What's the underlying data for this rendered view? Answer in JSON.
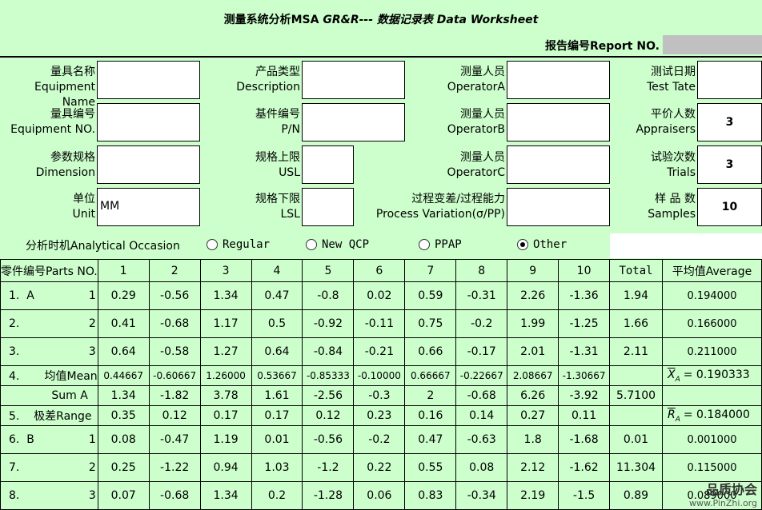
{
  "title": {
    "prefix": "测量系统分析MSA  ",
    "italic": "GR&R--- 数据记录表 Data Worksheet"
  },
  "report": {
    "label": "报告编号Report NO.",
    "value": ""
  },
  "fields": {
    "equipment_name": {
      "cn": "量具名称",
      "en": "Equipment Name",
      "value": ""
    },
    "equipment_no": {
      "cn": "量具编号",
      "en": "Equipment NO.",
      "value": ""
    },
    "dimension": {
      "cn": "参数规格",
      "en": "Dimension",
      "value": ""
    },
    "unit": {
      "cn": "单位",
      "en": "Unit",
      "value": "MM"
    },
    "description": {
      "cn": "产品类型",
      "en": "Description",
      "value": ""
    },
    "pn": {
      "cn": "基件编号",
      "en": "P/N",
      "value": ""
    },
    "usl": {
      "cn": "规格上限",
      "en": "USL",
      "value": ""
    },
    "lsl": {
      "cn": "规格下限",
      "en": "LSL",
      "value": ""
    },
    "operator_a": {
      "cn": "测量人员",
      "en": "OperatorA",
      "value": ""
    },
    "operator_b": {
      "cn": "测量人员",
      "en": "OperatorB",
      "value": ""
    },
    "operator_c": {
      "cn": "测量人员",
      "en": "OperatorC",
      "value": ""
    },
    "process_variation": {
      "cn": "过程变差/过程能力",
      "en": "Process Variation(σ/PP)",
      "value": ""
    },
    "test_date": {
      "cn": "测试日期",
      "en": "Test Tate",
      "value": ""
    },
    "appraisers": {
      "cn": "平价人数",
      "en": "Appraisers",
      "value": "3"
    },
    "trials": {
      "cn": "试验次数",
      "en": "Trials",
      "value": "3"
    },
    "samples": {
      "cn": "样 品 数",
      "en": "Samples",
      "value": "10"
    }
  },
  "occasion": {
    "label": "分析时机Analytical Occasion",
    "options": [
      "Regular",
      "New QCP",
      "PPAP",
      "Other"
    ],
    "selected": "Other"
  },
  "table": {
    "header_parts": "零件编号Parts NO.",
    "cols": [
      "1",
      "2",
      "3",
      "4",
      "5",
      "6",
      "7",
      "8",
      "9",
      "10"
    ],
    "total": "Total",
    "average": "平均值Average",
    "rows": [
      {
        "label": "1.  A",
        "num": "1",
        "vals": [
          "0.29",
          "-0.56",
          "1.34",
          "0.47",
          "-0.8",
          "0.02",
          "0.59",
          "-0.31",
          "2.26",
          "-1.36"
        ],
        "total": "1.94",
        "avg": "0.194000"
      },
      {
        "label": "2.",
        "num": "2",
        "vals": [
          "0.41",
          "-0.68",
          "1.17",
          "0.5",
          "-0.92",
          "-0.11",
          "0.75",
          "-0.2",
          "1.99",
          "-1.25"
        ],
        "total": "1.66",
        "avg": "0.166000"
      },
      {
        "label": "3.",
        "num": "3",
        "vals": [
          "0.64",
          "-0.58",
          "1.27",
          "0.64",
          "-0.84",
          "-0.21",
          "0.66",
          "-0.17",
          "2.01",
          "-1.31"
        ],
        "total": "2.11",
        "avg": "0.211000"
      },
      {
        "label": "4.       均值Mean",
        "num": "",
        "vals": [
          "0.44667",
          "-0.60667",
          "1.26000",
          "0.53667",
          "-0.85333",
          "-0.10000",
          "0.66667",
          "-0.22667",
          "2.08667",
          "-1.30667"
        ],
        "total": "",
        "avg": "= 0.190333",
        "avg_sym": "X",
        "avg_sub": "A"
      },
      {
        "label": "            Sum A",
        "num": "",
        "vals": [
          "1.34",
          "-1.82",
          "3.78",
          "1.61",
          "-2.56",
          "-0.3",
          "2",
          "-0.68",
          "6.26",
          "-3.92"
        ],
        "total": "5.7100",
        "avg": ""
      },
      {
        "label": "5.    极差Range",
        "num": "",
        "vals": [
          "0.35",
          "0.12",
          "0.17",
          "0.17",
          "0.12",
          "0.23",
          "0.16",
          "0.14",
          "0.27",
          "0.11"
        ],
        "total": "",
        "avg": "= 0.184000",
        "avg_sym": "R",
        "avg_sub": "A"
      },
      {
        "label": "6.  B",
        "num": "1",
        "vals": [
          "0.08",
          "-0.47",
          "1.19",
          "0.01",
          "-0.56",
          "-0.2",
          "0.47",
          "-0.63",
          "1.8",
          "-1.68"
        ],
        "total": "0.01",
        "avg": "0.001000"
      },
      {
        "label": "7.",
        "num": "2",
        "vals": [
          "0.25",
          "-1.22",
          "0.94",
          "1.03",
          "-1.2",
          "0.22",
          "0.55",
          "0.08",
          "2.12",
          "-1.62"
        ],
        "total": "11.304",
        "avg": "0.115000"
      },
      {
        "label": "8.",
        "num": "3",
        "vals": [
          "0.07",
          "-0.68",
          "1.34",
          "0.2",
          "-1.28",
          "0.06",
          "0.83",
          "-0.34",
          "2.19",
          "-1.5"
        ],
        "total": "0.89",
        "avg": "0.089000"
      }
    ]
  },
  "watermark": {
    "name": "品质协会",
    "url": "www.PinZhi.org"
  }
}
